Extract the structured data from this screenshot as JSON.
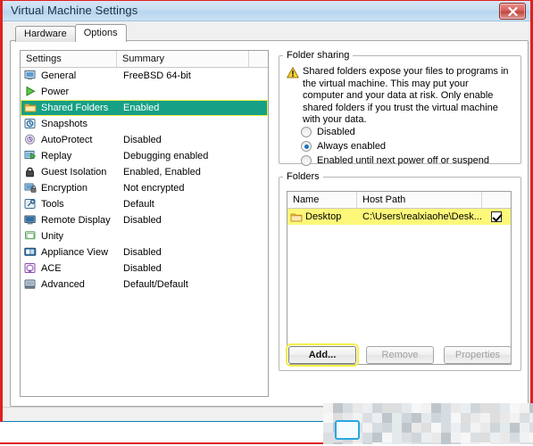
{
  "window": {
    "title": "Virtual Machine Settings",
    "close_icon": "close-icon"
  },
  "tabs": [
    {
      "label": "Hardware",
      "active": false
    },
    {
      "label": "Options",
      "active": true
    }
  ],
  "settings_list": {
    "headers": {
      "name": "Settings",
      "summary": "Summary"
    },
    "rows": [
      {
        "label": "General",
        "summary": "FreeBSD 64-bit",
        "icon": "monitor-icon",
        "selected": false
      },
      {
        "label": "Power",
        "summary": "",
        "icon": "power-play-icon",
        "selected": false
      },
      {
        "label": "Shared Folders",
        "summary": "Enabled",
        "icon": "folder-icon",
        "selected": true
      },
      {
        "label": "Snapshots",
        "summary": "",
        "icon": "snapshot-icon",
        "selected": false
      },
      {
        "label": "AutoProtect",
        "summary": "Disabled",
        "icon": "autoprotect-icon",
        "selected": false
      },
      {
        "label": "Replay",
        "summary": "Debugging enabled",
        "icon": "replay-icon",
        "selected": false
      },
      {
        "label": "Guest Isolation",
        "summary": "Enabled, Enabled",
        "icon": "lock-icon",
        "selected": false
      },
      {
        "label": "Encryption",
        "summary": "Not encrypted",
        "icon": "encryption-icon",
        "selected": false
      },
      {
        "label": "Tools",
        "summary": "Default",
        "icon": "tools-icon",
        "selected": false
      },
      {
        "label": "Remote Display",
        "summary": "Disabled",
        "icon": "remote-display-icon",
        "selected": false
      },
      {
        "label": "Unity",
        "summary": "",
        "icon": "unity-icon",
        "selected": false
      },
      {
        "label": "Appliance View",
        "summary": "Disabled",
        "icon": "appliance-view-icon",
        "selected": false
      },
      {
        "label": "ACE",
        "summary": "Disabled",
        "icon": "ace-icon",
        "selected": false
      },
      {
        "label": "Advanced",
        "summary": "Default/Default",
        "icon": "advanced-icon",
        "selected": false
      }
    ]
  },
  "folder_sharing": {
    "legend": "Folder sharing",
    "warning_icon": "warning-triangle-icon",
    "warning_text": "Shared folders expose your files to programs in the virtual machine. This may put your computer and your data at risk. Only enable shared folders if you trust the virtual machine with your data.",
    "options": [
      {
        "label": "Disabled",
        "checked": false
      },
      {
        "label": "Always enabled",
        "checked": true
      },
      {
        "label": "Enabled until next power off or suspend",
        "checked": false
      }
    ]
  },
  "folders": {
    "legend": "Folders",
    "headers": {
      "name": "Name",
      "host_path": "Host Path",
      "enabled": ""
    },
    "rows": [
      {
        "name": "Desktop",
        "host_path": "C:\\Users\\realxiaohe\\Desk...",
        "enabled": true,
        "icon": "folder-icon"
      }
    ],
    "buttons": [
      {
        "label": "Add...",
        "enabled": true,
        "highlighted": true
      },
      {
        "label": "Remove",
        "enabled": false,
        "highlighted": false
      },
      {
        "label": "Properties",
        "enabled": false,
        "highlighted": false
      }
    ]
  },
  "colors": {
    "selection_teal": "#16a085",
    "highlight_yellow": "#f4ef4a",
    "row_yellow": "#fdf87a",
    "frame_red": "#e02020",
    "titlebar_blue": "#c3dcf1"
  }
}
